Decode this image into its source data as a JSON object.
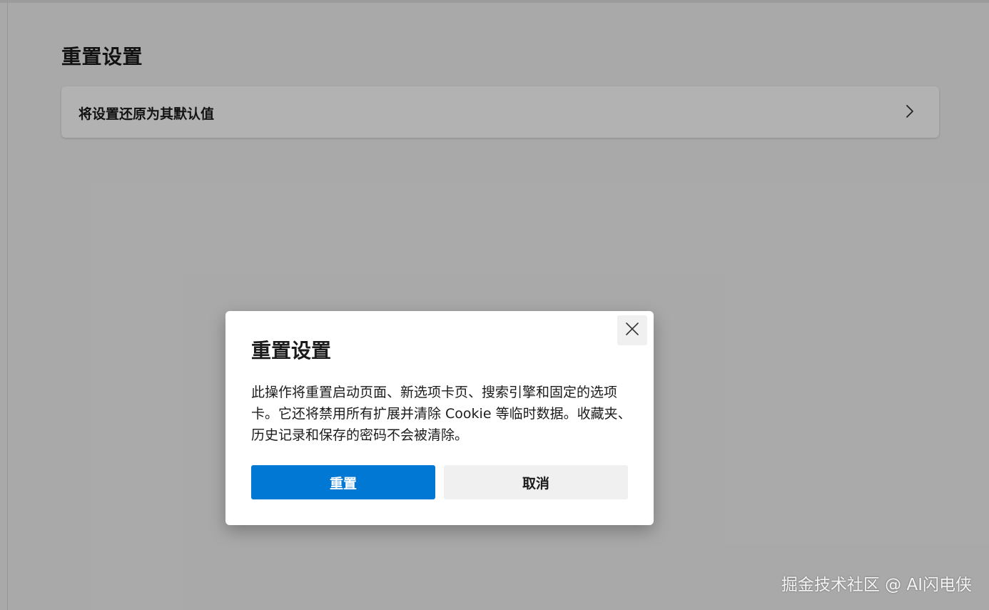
{
  "settings": {
    "page_title": "重置设置",
    "reset_card_label": "将设置还原为其默认值",
    "reset_card_icon": "chevron-right-icon"
  },
  "dialog": {
    "title": "重置设置",
    "body": "此操作将重置启动页面、新选项卡页、搜索引擎和固定的选项卡。它还将禁用所有扩展并清除 Cookie 等临时数据。收藏夹、历史记录和保存的密码不会被清除。",
    "confirm_label": "重置",
    "cancel_label": "取消",
    "close_icon": "close-icon"
  },
  "watermark": {
    "text": "掘金技术社区 @ AI闪电侠"
  },
  "colors": {
    "primary_button": "#0078d4",
    "secondary_button": "#f0f0f0",
    "overlay": "rgba(0,0,0,0.30)"
  }
}
